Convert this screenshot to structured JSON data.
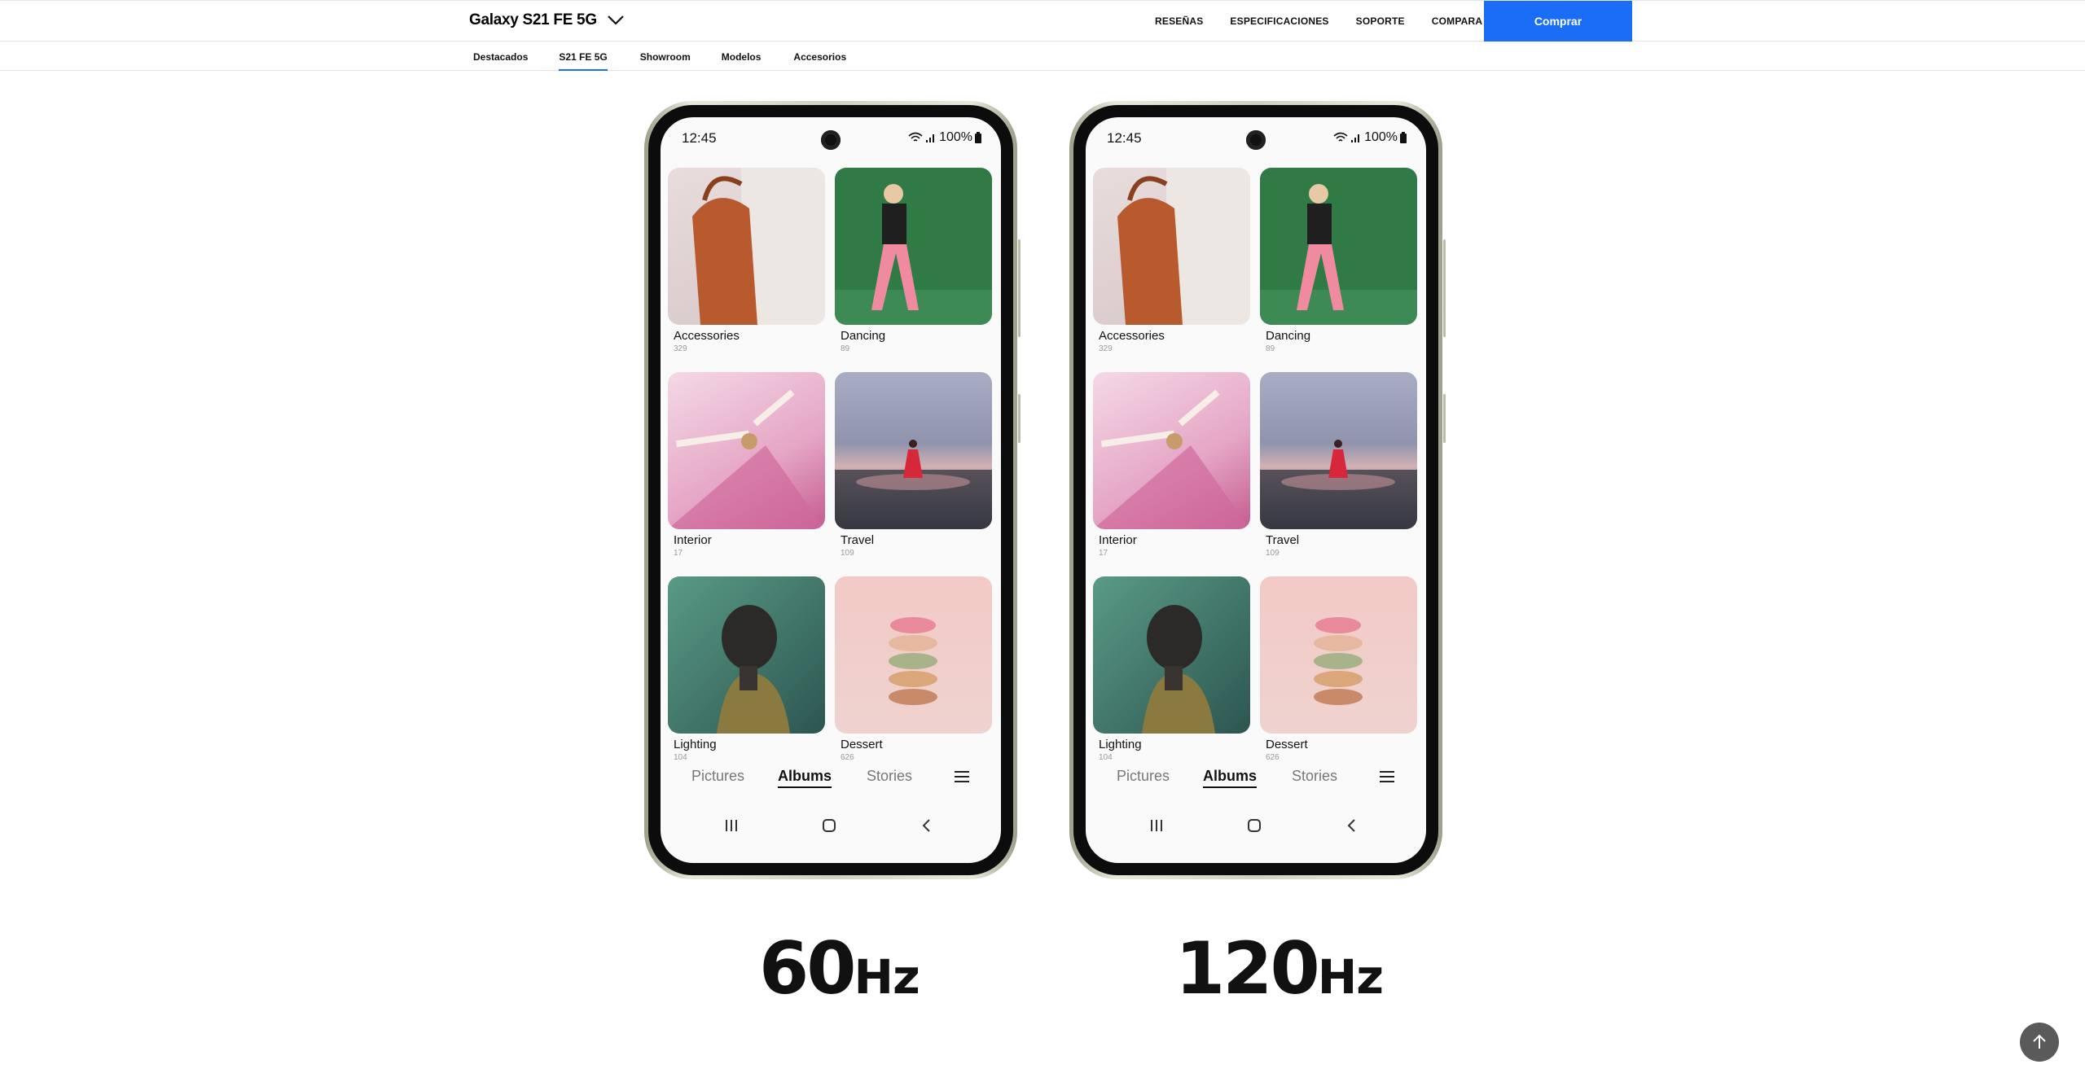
{
  "header": {
    "product_title": "Galaxy S21 FE 5G",
    "menu": [
      "RESEÑAS",
      "ESPECIFICACIONES",
      "SOPORTE",
      "COMPARA"
    ],
    "buy_label": "Comprar"
  },
  "subnav": {
    "items": [
      "Destacados",
      "S21 FE 5G",
      "Showroom",
      "Modelos",
      "Accesorios"
    ],
    "active": "S21 FE 5G"
  },
  "phone": {
    "time": "12:45",
    "battery": "100%",
    "albums": [
      {
        "name": "Accessories",
        "count": "329"
      },
      {
        "name": "Dancing",
        "count": "89"
      },
      {
        "name": "Interior",
        "count": "17"
      },
      {
        "name": "Travel",
        "count": "109"
      },
      {
        "name": "Lighting",
        "count": "104"
      },
      {
        "name": "Dessert",
        "count": "626"
      }
    ],
    "tabs": [
      "Pictures",
      "Albums",
      "Stories"
    ],
    "active_tab": "Albums"
  },
  "comparison": {
    "left": {
      "value": "60",
      "unit": "Hz"
    },
    "right": {
      "value": "120",
      "unit": "Hz"
    }
  },
  "colors": {
    "accent": "#1b6df5",
    "scroll_button": "#5a5a5a"
  }
}
